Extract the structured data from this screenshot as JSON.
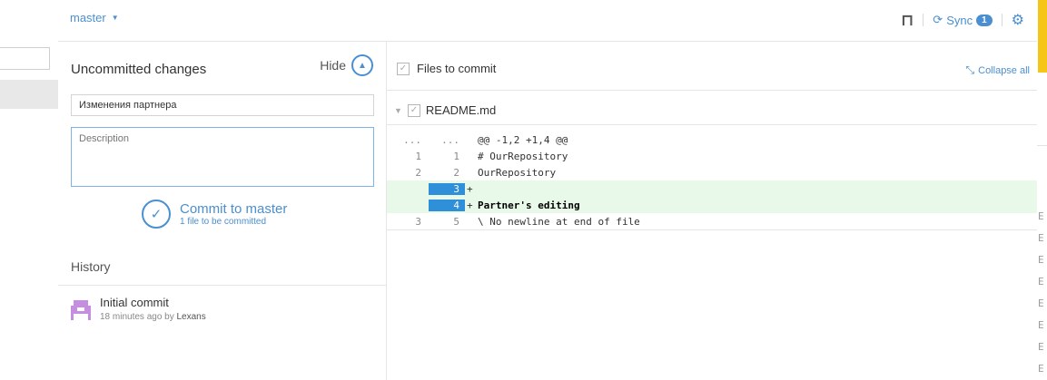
{
  "topbar": {
    "branch": "master",
    "sync_label": "Sync",
    "sync_count": "1"
  },
  "left": {
    "uncommitted_title": "Uncommitted changes",
    "hide_label": "Hide",
    "summary_value": "Изменения партнера",
    "description_placeholder": "Description",
    "commit_label": "Commit to master",
    "commit_sub": "1 file to be committed",
    "history_title": "History",
    "history": [
      {
        "title": "Initial commit",
        "time": "18 minutes ago by",
        "author": "Lexans"
      }
    ]
  },
  "right": {
    "files_title": "Files to commit",
    "collapse_label": "Collapse all",
    "file_name": "README.md",
    "diff": [
      {
        "old": "...",
        "new": "...",
        "mark": "",
        "code": "@@ -1,2 +1,4 @@",
        "type": "hunk"
      },
      {
        "old": "1",
        "new": "1",
        "mark": "",
        "code": "# OurRepository",
        "type": "ctx"
      },
      {
        "old": "2",
        "new": "2",
        "mark": "",
        "code": "OurRepository",
        "type": "ctx"
      },
      {
        "old": "",
        "new": "3",
        "mark": "+",
        "code": "",
        "type": "add"
      },
      {
        "old": "",
        "new": "4",
        "mark": "+",
        "code": "Partner's editing",
        "type": "add"
      },
      {
        "old": "3",
        "new": "5",
        "mark": "",
        "code": "\\ No newline at end of file",
        "type": "ctx"
      }
    ]
  },
  "colors": {
    "accent": "#4a8fd1",
    "added_bg": "#e9f9e9",
    "added_gutter": "#2f8fd9",
    "avatar": "#c58ee0"
  }
}
